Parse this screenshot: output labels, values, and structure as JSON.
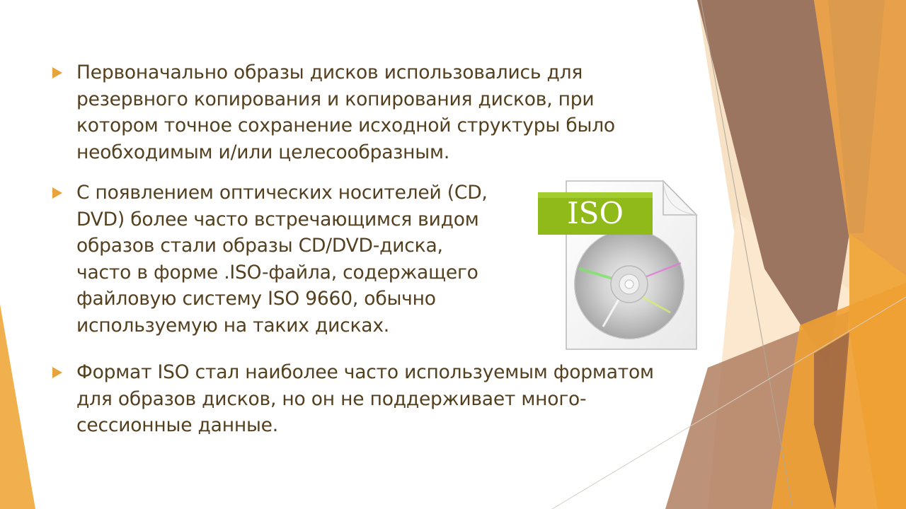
{
  "bullets": [
    {
      "lines": [
        "Первоначально образы дисков использовались для",
        "резервного копирования и копирования дисков, при",
        "котором точное сохранение исходной структуры было",
        "необходимым и/или целесообразным."
      ]
    },
    {
      "lines": [
        "С появлением оптических носителей (CD,",
        "DVD) более часто встречающимся видом",
        "образов стали образы CD/DVD-диска,",
        "часто в форме .ISO-файла, содержащего",
        "файловую систему ISO 9660, обычно",
        "используемую на таких дисках."
      ]
    },
    {
      "lines": [
        "Формат ISO стал наиболее часто используемым форматом",
        "для образов дисков, но он не поддерживает много-",
        "сессионные данные."
      ]
    }
  ],
  "iso_icon": {
    "label": "ISO",
    "icon": "iso-disc-file-icon"
  },
  "colors": {
    "text": "#54401f",
    "bullet_arrow": "#e8a33b",
    "iso_badge": "#8fba1a",
    "facet_orange": "#f0a23c",
    "facet_brown": "#9b6e58"
  }
}
